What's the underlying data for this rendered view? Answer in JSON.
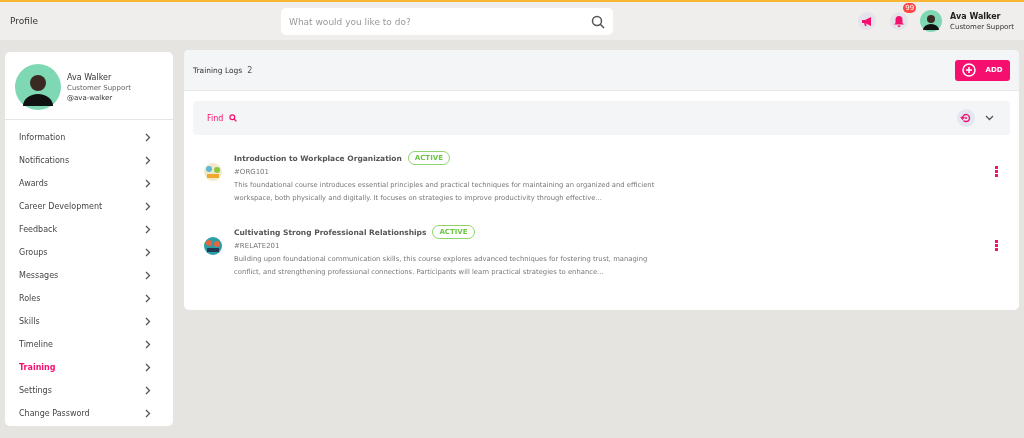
{
  "topbar": {
    "title": "Profile",
    "search": {
      "placeholder": "What would you like to do?"
    },
    "notifications_badge": "99",
    "user": {
      "name": "Ava Walker",
      "role": "Customer Support"
    }
  },
  "profile": {
    "name": "Ava Walker",
    "role": "Customer Support",
    "handle": "@ava-walker"
  },
  "sidebar": {
    "items": [
      {
        "label": "Information",
        "selected": false
      },
      {
        "label": "Notifications",
        "selected": false
      },
      {
        "label": "Awards",
        "selected": false
      },
      {
        "label": "Career Development",
        "selected": false
      },
      {
        "label": "Feedback",
        "selected": false
      },
      {
        "label": "Groups",
        "selected": false
      },
      {
        "label": "Messages",
        "selected": false
      },
      {
        "label": "Roles",
        "selected": false
      },
      {
        "label": "Skills",
        "selected": false
      },
      {
        "label": "Timeline",
        "selected": false
      },
      {
        "label": "Training",
        "selected": true
      },
      {
        "label": "Settings",
        "selected": false
      },
      {
        "label": "Change Password",
        "selected": false
      }
    ]
  },
  "panel": {
    "title": "Training Logs",
    "count": "2",
    "add_button": "ADD",
    "find_label": "Find"
  },
  "courses": [
    {
      "title": "Introduction to Workplace Organization",
      "status": "ACTIVE",
      "code": "#ORG101",
      "description": "This foundational course introduces essential principles and practical techniques for maintaining an organized and efficient workspace, both physically and digitally. It focuses on strategies to improve productivity through effective...",
      "kind": "picture"
    },
    {
      "title": "Cultivating Strong Professional Relationships",
      "status": "ACTIVE",
      "code": "#RELATE201",
      "description": "Building upon foundational communication skills, this course explores advanced techniques for fostering trust, managing conflict, and strengthening professional connections. Participants will learn practical strategies to enhance...",
      "kind": "picture"
    }
  ]
}
